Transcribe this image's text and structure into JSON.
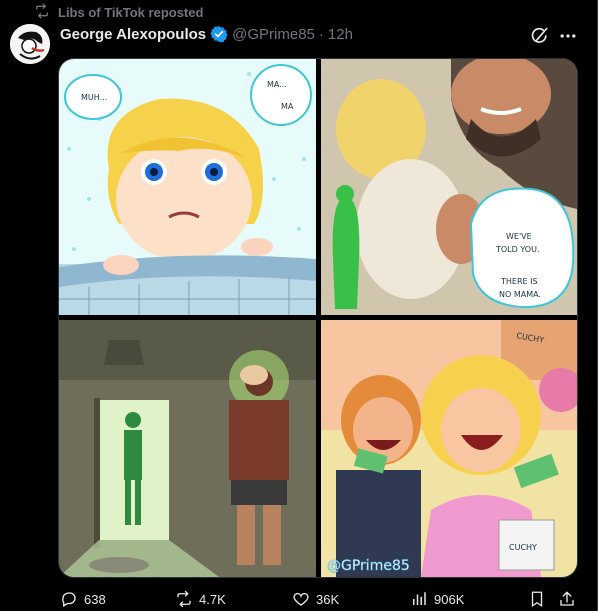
{
  "repost": {
    "text": "Libs of TikTok reposted"
  },
  "tweet": {
    "author_name": "George Alexopoulos",
    "handle": "@GPrime85",
    "separator": "·",
    "time": "12h",
    "verified": true
  },
  "comic": {
    "p1_bubble_left": "MUH...",
    "p1_bubble_right_1": "MA...",
    "p1_bubble_right_2": "MA",
    "p2_line_1": "WE'VE",
    "p2_line_2": "TOLD YOU.",
    "p2_line_3": "THERE IS",
    "p2_line_4": "NO MAMA.",
    "p4_bag_text": "CUCHY",
    "p4_sign_text": "CUCHY",
    "watermark": "@GPrime85"
  },
  "actions": {
    "replies": "638",
    "reposts": "4.7K",
    "likes": "36K",
    "views": "906K"
  },
  "icons": {
    "repost": "repost-icon",
    "verified": "verified-badge-icon",
    "grok": "grok-icon",
    "more": "more-icon",
    "reply": "reply-icon",
    "like": "like-icon",
    "views": "views-icon",
    "bookmark": "bookmark-icon",
    "share": "share-icon"
  },
  "colors": {
    "background": "#000000",
    "text_primary": "#e7e9ea",
    "text_secondary": "#71767b",
    "verified": "#1d9bf0",
    "border": "#2f3336"
  }
}
